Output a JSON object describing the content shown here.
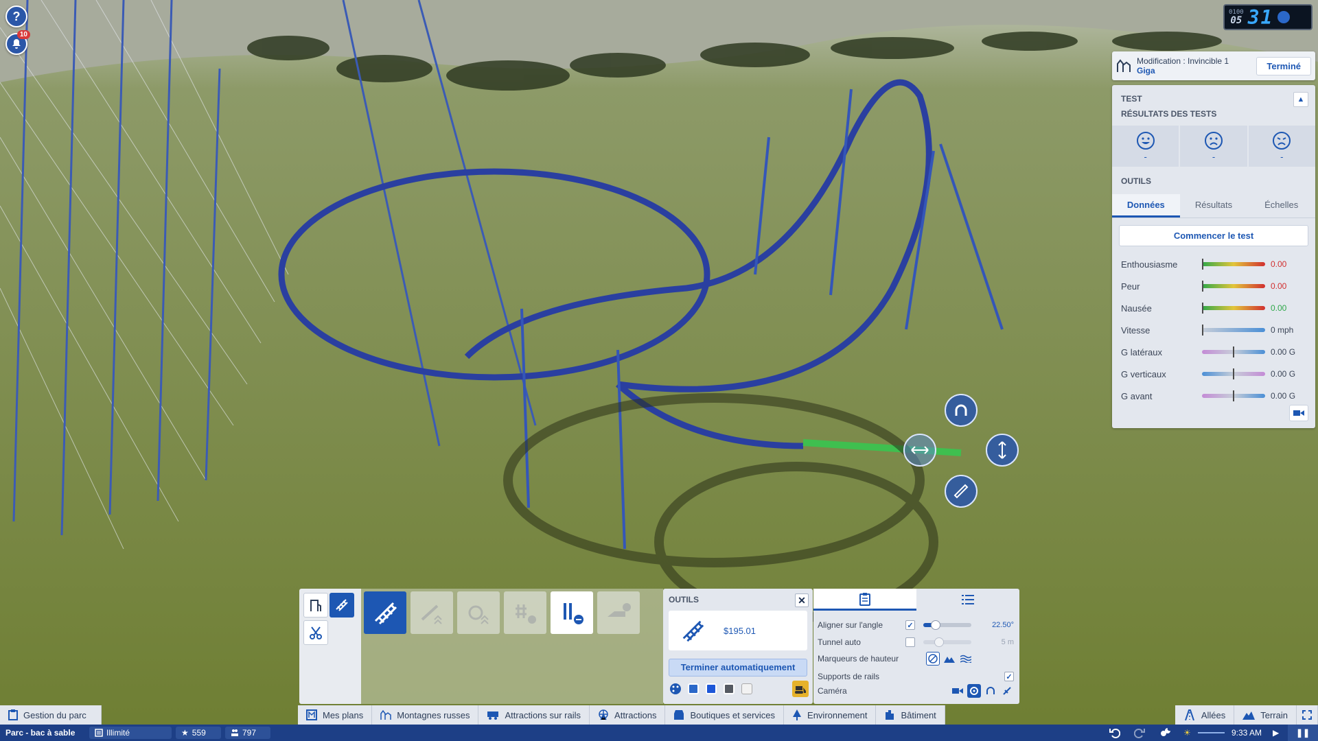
{
  "notifications": {
    "count": "10",
    "help_label": "?"
  },
  "clock": {
    "top": "0100",
    "day": "05",
    "big": "31"
  },
  "ride_header": {
    "prefix": "Modification : Invincible 1",
    "type": "Giga",
    "done_label": "Terminé"
  },
  "test_panel": {
    "section_title": "TEST",
    "results_title": "RÉSULTATS DES TESTS",
    "ratings": [
      {
        "icon": "happy-face-icon",
        "value": "-"
      },
      {
        "icon": "neutral-face-icon",
        "value": "-"
      },
      {
        "icon": "sad-face-icon",
        "value": "-"
      }
    ],
    "tools_title": "OUTILS",
    "tabs": [
      "Données",
      "Résultats",
      "Échelles"
    ],
    "active_tab": "Données",
    "start_label": "Commencer le test",
    "stats": [
      {
        "label": "Enthousiasme",
        "value": "0.00",
        "color": "#d12f2f"
      },
      {
        "label": "Peur",
        "value": "0.00",
        "color": "#d12f2f"
      },
      {
        "label": "Nausée",
        "value": "0.00",
        "color": "#2fa84a"
      },
      {
        "label": "Vitesse",
        "value": "0 mph",
        "color": "#3b4557"
      },
      {
        "label": "G latéraux",
        "value": "0.00 G",
        "color": "#3b4557"
      },
      {
        "label": "G verticaux",
        "value": "0.00 G",
        "color": "#3b4557"
      },
      {
        "label": "G avant",
        "value": "0.00 G",
        "color": "#3b4557"
      }
    ]
  },
  "outils_panel": {
    "title": "OUTILS",
    "price": "$195.01",
    "auto_complete": "Terminer automatiquement",
    "swatches": [
      "#2b68c9",
      "#1d57d8",
      "#555a62",
      "#f2f2f2"
    ]
  },
  "settings_panel": {
    "align_label": "Aligner sur l'angle",
    "align_value": "22.50°",
    "align_fraction": 0.25,
    "tunnel_label": "Tunnel auto",
    "tunnel_value": "5 m",
    "height_markers_label": "Marqueurs de hauteur",
    "supports_label": "Supports de rails",
    "camera_label": "Caméra"
  },
  "bottom_bar": {
    "park_management": "Gestion du parc",
    "tabs": [
      "Mes plans",
      "Montagnes russes",
      "Attractions sur rails",
      "Attractions",
      "Boutiques et services",
      "Environnement",
      "Bâtiment"
    ],
    "paths": "Allées",
    "terrain": "Terrain"
  },
  "status_bar": {
    "park_name": "Parc - bac à sable",
    "money": "Illimité",
    "rating": "559",
    "guests": "797",
    "time": "9:33 AM"
  }
}
